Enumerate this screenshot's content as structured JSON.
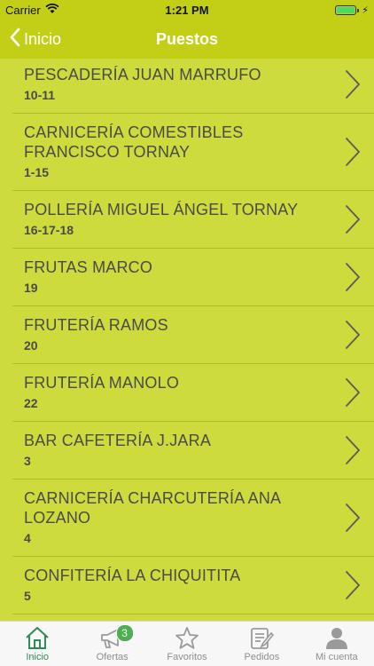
{
  "status_bar": {
    "carrier": "Carrier",
    "time": "1:21 PM",
    "battery_level": 1.0
  },
  "nav": {
    "back_label": "Inicio",
    "title": "Puestos"
  },
  "stalls": [
    {
      "name": "PESCADERÍA JUAN MARRUFO",
      "number": "10-11"
    },
    {
      "name": "CARNICERÍA COMESTIBLES FRANCISCO TORNAY",
      "number": "1-15"
    },
    {
      "name": "POLLERÍA MIGUEL ÁNGEL TORNAY",
      "number": "16-17-18"
    },
    {
      "name": "FRUTAS MARCO",
      "number": "19"
    },
    {
      "name": "FRUTERÍA RAMOS",
      "number": "20"
    },
    {
      "name": "FRUTERÍA MANOLO",
      "number": "22"
    },
    {
      "name": "BAR CAFETERÍA J.JARA",
      "number": "3"
    },
    {
      "name": "CARNICERÍA CHARCUTERÍA ANA LOZANO",
      "number": "4"
    },
    {
      "name": "CONFITERÍA LA CHIQUITITA",
      "number": "5"
    }
  ],
  "tabs": [
    {
      "label": "Inicio",
      "icon": "home-icon",
      "active": true
    },
    {
      "label": "Ofertas",
      "icon": "megaphone-icon",
      "badge": "3"
    },
    {
      "label": "Favoritos",
      "icon": "star-icon"
    },
    {
      "label": "Pedidos",
      "icon": "orders-icon"
    },
    {
      "label": "Mi cuenta",
      "icon": "user-icon"
    }
  ],
  "colors": {
    "bar": "#c3cf16",
    "background": "#cddc3c",
    "active_tab": "#2e8b57",
    "badge": "#4caf50"
  }
}
